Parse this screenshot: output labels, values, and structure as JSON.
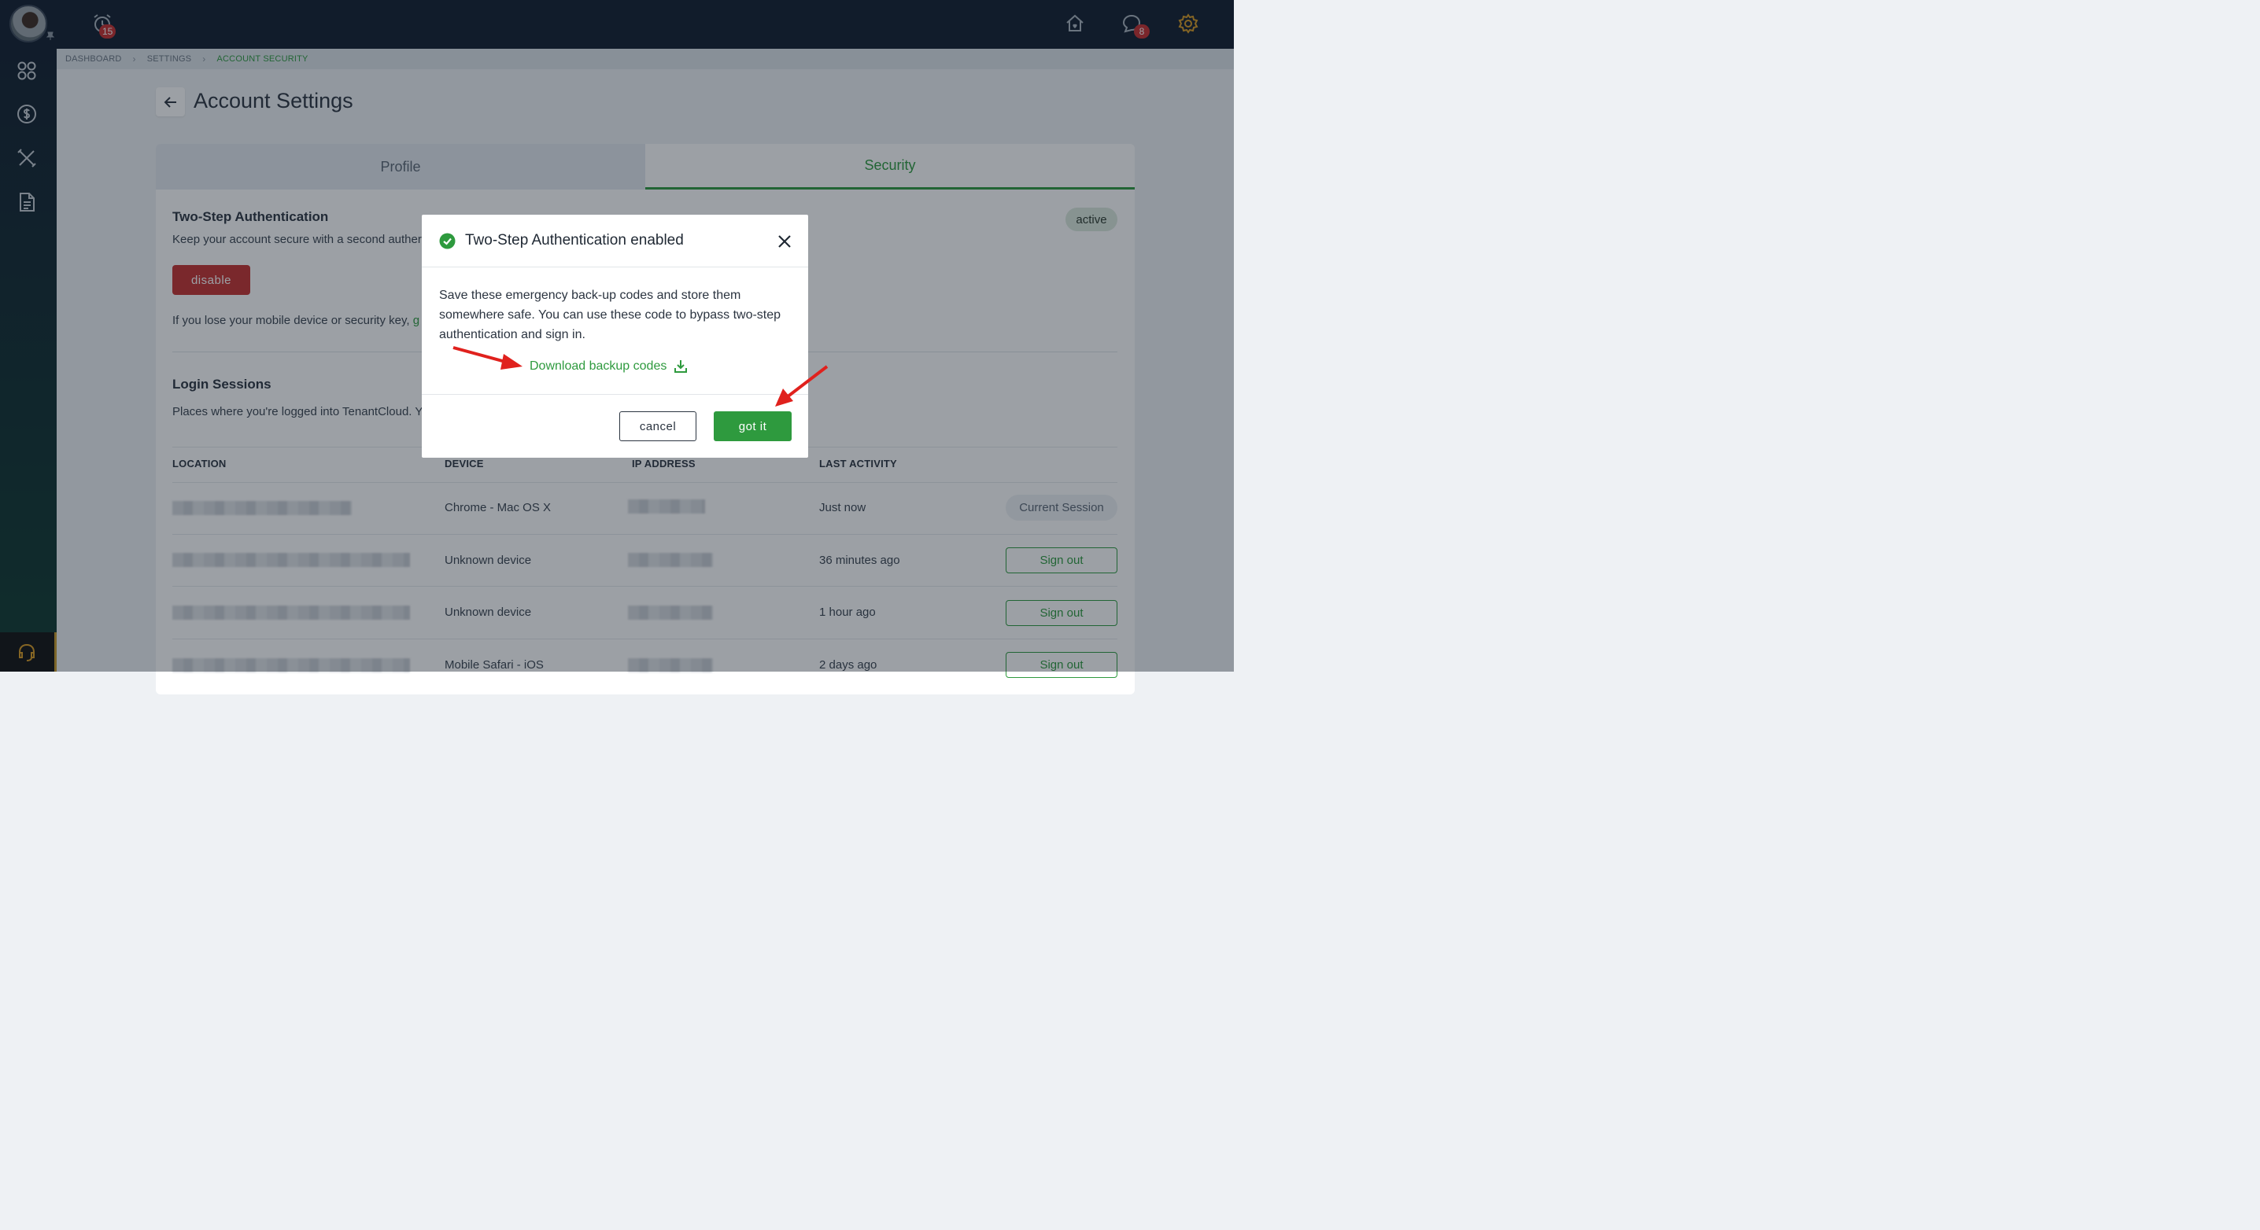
{
  "topbar": {
    "alarm_badge": "15",
    "chat_badge": "8",
    "icons": [
      "avatar",
      "alarm-icon",
      "home-icon",
      "chat-icon",
      "gear-icon"
    ]
  },
  "rail": {
    "icons": [
      "dashboard-grid-icon",
      "dollar-icon",
      "tools-icon",
      "document-icon",
      "headset-icon"
    ]
  },
  "breadcrumb": {
    "items": [
      "DASHBOARD",
      "SETTINGS",
      "ACCOUNT SECURITY"
    ]
  },
  "page": {
    "title": "Account Settings"
  },
  "tabs": {
    "profile": "Profile",
    "security": "Security"
  },
  "two_step": {
    "title": "Two-Step Authentication",
    "description": "Keep your account secure with a second auther",
    "status": "active",
    "disable_label": "disable",
    "lost_device_text": "If you lose your mobile device or security key,",
    "lost_device_link_fragment": "g"
  },
  "sessions": {
    "title": "Login Sessions",
    "description": "Places where you're logged into TenantCloud. Y",
    "columns": [
      "LOCATION",
      "DEVICE",
      "IP ADDRESS",
      "LAST ACTIVITY"
    ],
    "rows": [
      {
        "device": "Chrome - Mac OS X",
        "last_activity": "Just now",
        "action": "Current Session"
      },
      {
        "device": "Unknown device",
        "last_activity": "36 minutes ago",
        "action": "Sign out"
      },
      {
        "device": "Unknown device",
        "last_activity": "1 hour ago",
        "action": "Sign out"
      },
      {
        "device": "Mobile Safari - iOS",
        "last_activity": "2 days ago",
        "action": "Sign out"
      }
    ]
  },
  "modal": {
    "title": "Two-Step Authentication enabled",
    "body": "Save these emergency back-up codes and store them somewhere safe. You can use these code to bypass two-step authentication and sign in.",
    "download_label": "Download backup codes",
    "cancel_label": "cancel",
    "confirm_label": "got it"
  },
  "colors": {
    "accent": "#2e9a3e",
    "danger": "#c4312f",
    "annotation_arrow": "#e0211d",
    "topbar": "#111d2e"
  }
}
